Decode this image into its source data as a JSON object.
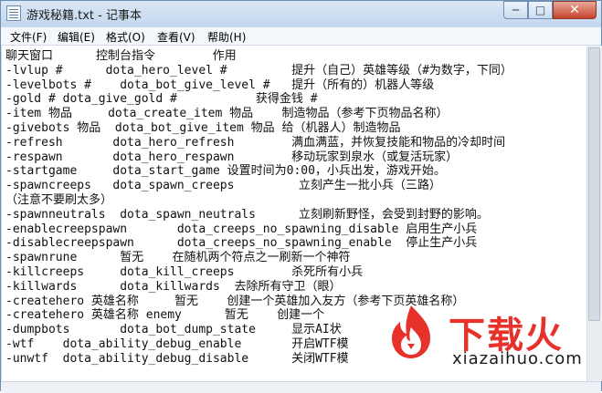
{
  "window": {
    "title": "游戏秘籍.txt - 记事本",
    "min_label": "─",
    "max_label": "□",
    "close_label": "✕"
  },
  "menu": [
    "文件(F)",
    "编辑(E)",
    "格式(O)",
    "查看(V)",
    "帮助(H)"
  ],
  "document": {
    "lines": [
      "聊天窗口      控制台指令        作用",
      "-lvlup #      dota_hero_level #         提升（自己）英雄等级（#为数字，下同）",
      "-levelbots #    dota_bot_give_level #   提升（所有的）机器人等级",
      "-gold # dota_give_gold #           获得金钱 #",
      "-item 物品     dota_create_item 物品    制造物品（参考下页物品名称）",
      "-givebots 物品  dota_bot_give_item 物品 给（机器人）制造物品",
      "-refresh       dota_hero_refresh        满血满蓝，并恢复技能和物品的冷却时间",
      "-respawn       dota_hero_respawn        移动玩家到泉水（或复活玩家）",
      "-startgame     dota_start_game 设置时间为0:00，小兵出发，游戏开始。",
      "-spawncreeps   dota_spawn_creeps         立刻产生一批小兵（三路）",
      "（注意不要刷太多）",
      "-spawnneutrals  dota_spawn_neutrals      立刻刷新野怪，会受到封野的影响。",
      "-enablecreepspawn       dota_creeps_no_spawning_disable 启用生产小兵",
      "-disablecreepspawn      dota_creeps_no_spawning_enable  停止生产小兵",
      "-spawnrune      暂无    在随机两个符点之一刷新一个神符",
      "-killcreeps     dota_kill_creeps        杀死所有小兵",
      "-killwards      dota_killwards  去除所有守卫（眼）",
      "-createhero 英雄名称     暂无    创建一个英雄加入友方（参考下页英雄名称）",
      "-createhero 英雄名称 enemy      暂无    创建一个",
      "-dumpbots       dota_bot_dump_state     显示AI状",
      "-wtf    dota_ability_debug_enable       开启WTF模",
      "-unwtf  dota_ability_debug_disable      关闭WTF模"
    ]
  },
  "watermark": {
    "brand": "下载火",
    "url": "xiazaihuo.com",
    "accent": "#e6322a"
  }
}
